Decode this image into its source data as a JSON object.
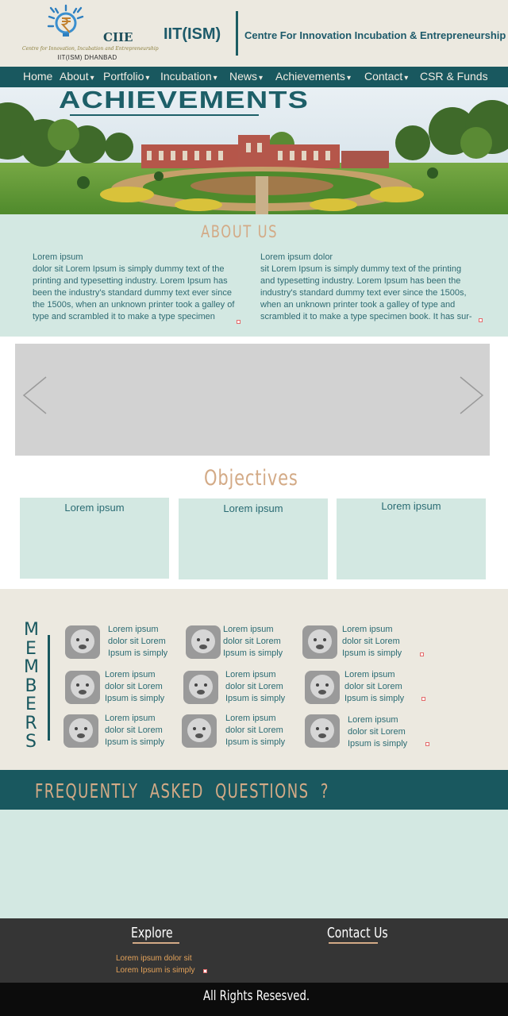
{
  "header": {
    "logo": {
      "name": "CIIE",
      "tagline": "Centre for Innovation, Incubation and Entrepreneurship",
      "subtitle": "IIT(ISM) DHANBAD"
    },
    "institute": "IIT(ISM)",
    "tagline": "Centre For Innovation Incubation & Entrepreneurship"
  },
  "nav": {
    "items": [
      {
        "label": "Home",
        "caret": ""
      },
      {
        "label": "About",
        "caret": "▾"
      },
      {
        "label": "Portfolio",
        "caret": "▾"
      },
      {
        "label": "Incubation",
        "caret": "▾"
      },
      {
        "label": "News",
        "caret": "▾"
      },
      {
        "label": "Achievements",
        "caret": "▾"
      },
      {
        "label": "Contact",
        "caret": "▾"
      },
      {
        "label": "CSR & Funds",
        "caret": ""
      }
    ]
  },
  "hero": {
    "title": "ACHIEVEMENTS"
  },
  "about": {
    "heading": "ABOUT US",
    "left": {
      "title": "Lorem ipsum",
      "body": "dolor sit Lorem Ipsum is simply dummy text of the printing and typesetting industry. Lorem Ipsum has been the industry's standard dummy text ever since the 1500s, when an unknown printer took a galley of type and scrambled it to make a type specimen"
    },
    "right": {
      "title": "Lorem ipsum dolor",
      "body": "sit Lorem Ipsum is simply dummy text of the printing and typesetting industry. Lorem Ipsum has been the industry's standard dummy text ever since the 1500s, when an unknown printer took a galley of type and scrambled it to make a type specimen book. It has sur-"
    }
  },
  "slider": {
    "prev_icon": "chevron-left-icon",
    "next_icon": "chevron-right-icon"
  },
  "objectives": {
    "heading": "Objectives",
    "cards": [
      {
        "title": "Lorem ipsum"
      },
      {
        "title": "Lorem ipsum"
      },
      {
        "title": "Lorem ipsum"
      }
    ]
  },
  "members": {
    "label": "MEMBERS",
    "items": [
      {
        "line1": "Lorem ipsum",
        "line2": "dolor sit Lorem",
        "line3": "Ipsum is simply"
      },
      {
        "line1": "Lorem ipsum",
        "line2": "dolor sit Lorem",
        "line3": "Ipsum is simply"
      },
      {
        "line1": "Lorem ipsum",
        "line2": "dolor sit Lorem",
        "line3": "Ipsum is simply"
      },
      {
        "line1": "Lorem ipsum",
        "line2": "dolor sit Lorem",
        "line3": "Ipsum is simply"
      },
      {
        "line1": "Lorem ipsum",
        "line2": "dolor sit Lorem",
        "line3": "Ipsum is simply"
      },
      {
        "line1": "Lorem ipsum",
        "line2": "dolor sit Lorem",
        "line3": "Ipsum is simply"
      },
      {
        "line1": "Lorem ipsum",
        "line2": "dolor sit Lorem",
        "line3": "Ipsum is simply"
      },
      {
        "line1": "Lorem ipsum",
        "line2": "dolor sit Lorem",
        "line3": "Ipsum is simply"
      },
      {
        "line1": "Lorem ipsum",
        "line2": "dolor sit Lorem",
        "line3": "Ipsum is simply"
      }
    ]
  },
  "faq": {
    "title": "FREQUENTLY  ASKED  QUESTIONS  ?"
  },
  "footer": {
    "explore": {
      "heading": "Explore",
      "line1": "Lorem ipsum dolor sit",
      "line2": "Lorem Ipsum is simply"
    },
    "contact": {
      "heading": "Contact Us"
    },
    "copyright": "All Rights Resesved."
  },
  "colors": {
    "teal": "#19585f",
    "mint": "#d3e8e2",
    "beige": "#ece9e0",
    "peach": "#d3aa86",
    "footer": "#353535"
  }
}
